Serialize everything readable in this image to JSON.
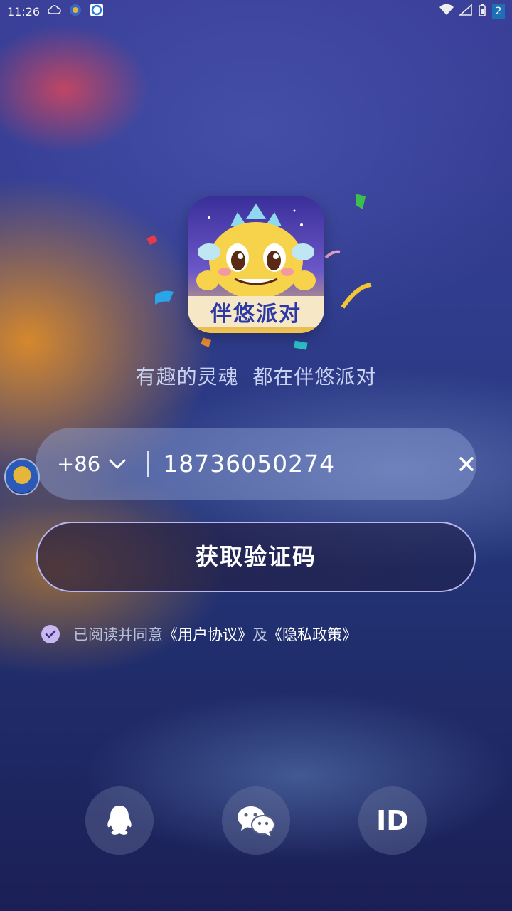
{
  "status_bar": {
    "time": "11:26",
    "badge": "2",
    "icons": [
      "cloud-icon",
      "app-notify-icon",
      "browser-icon",
      "wifi-icon",
      "signal-icon",
      "battery-icon"
    ]
  },
  "logo": {
    "text": "伴悠派对",
    "icon": "dragon-mascot-icon"
  },
  "tagline": "有趣的灵魂  都在伴悠派对",
  "login": {
    "country_code": "+86",
    "phone_value": "18736050274",
    "get_code_label": "获取验证码"
  },
  "agreement": {
    "prefix": "已阅读并同意",
    "user_agreement": "《用户协议》",
    "and": "及",
    "privacy_policy": "《隐私政策》",
    "checked": true
  },
  "social_login": {
    "qq_icon": "qq-icon",
    "wechat_icon": "wechat-icon",
    "id_label": "ID"
  },
  "colors": {
    "accent": "#c7b7f2",
    "button_border": "#b9b6f2",
    "tagline": "#c9d3f0"
  }
}
